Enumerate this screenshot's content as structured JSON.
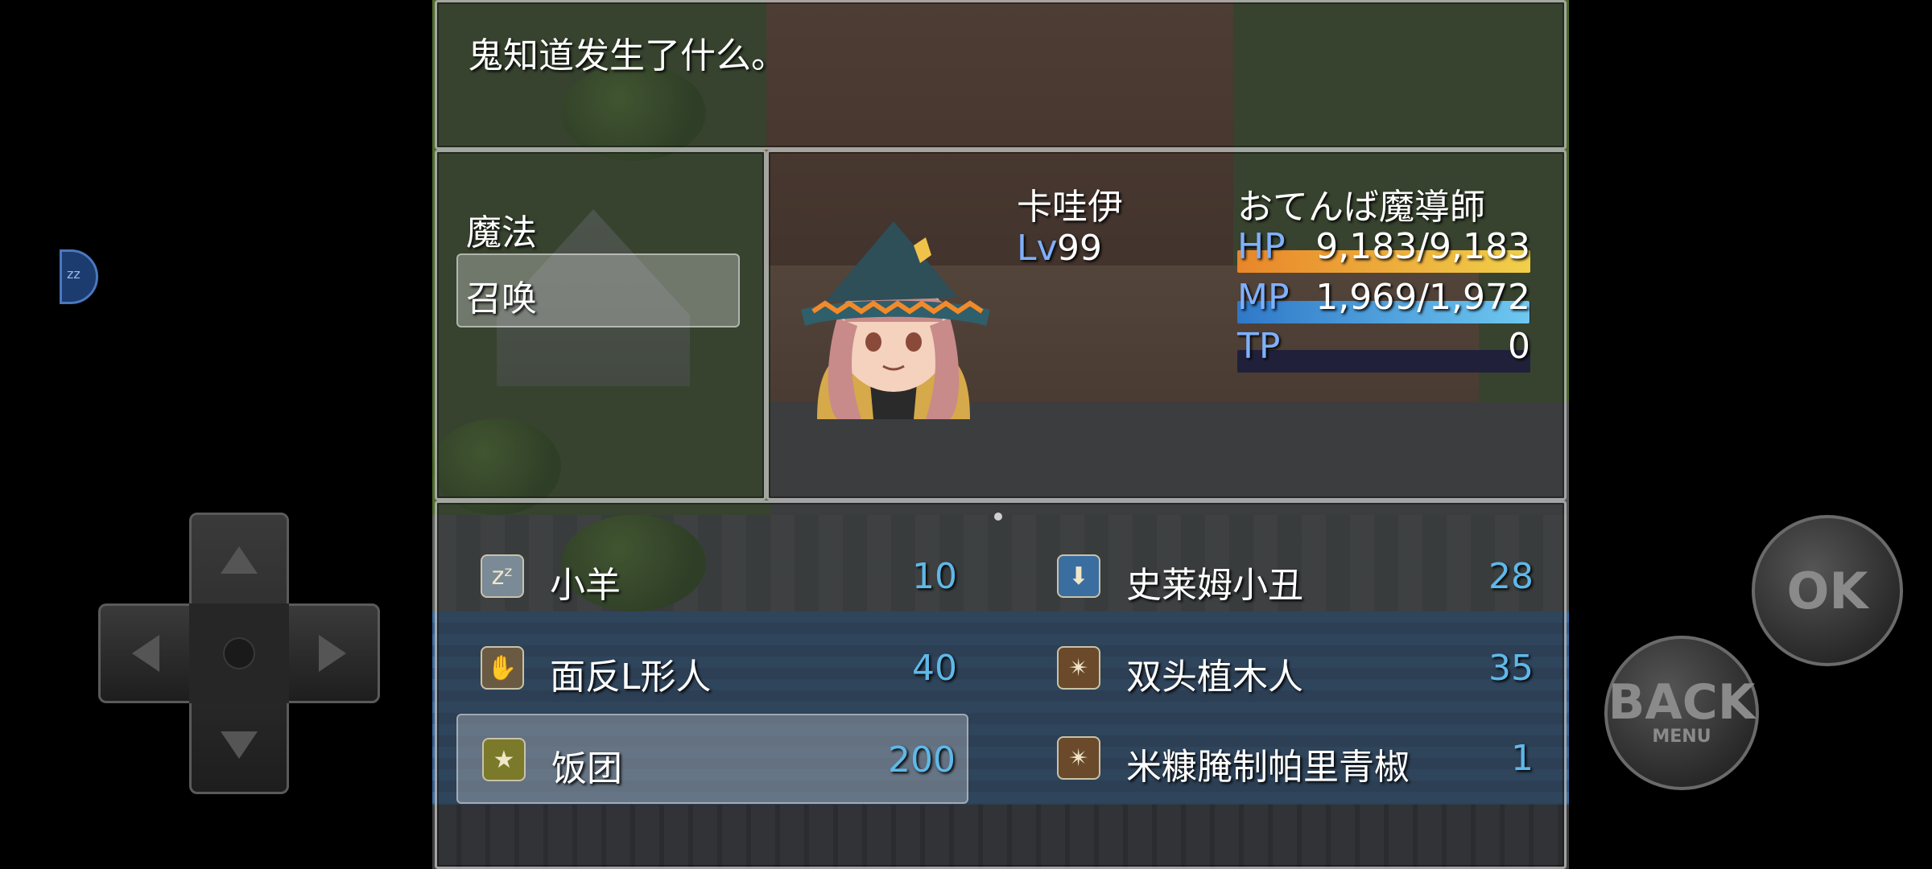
{
  "message": {
    "text": "鬼知道发生了什么。"
  },
  "command_menu": {
    "items": [
      "魔法",
      "召唤"
    ],
    "selected_index": 1
  },
  "actor": {
    "name": "卡哇伊",
    "class": "おてんば魔導師",
    "level_label": "Lv",
    "level": "99",
    "hp_label": "HP",
    "hp": "9,183/9,183",
    "hp_fraction": 1.0,
    "mp_label": "MP",
    "mp": "1,969/1,972",
    "mp_fraction": 0.998,
    "tp_label": "TP",
    "tp": "0",
    "tp_fraction": 0.0
  },
  "skills": [
    {
      "name": "小羊",
      "cost": "10",
      "icon": "sleep-zzz-icon"
    },
    {
      "name": "史莱姆小丑",
      "cost": "28",
      "icon": "water-drop-icon"
    },
    {
      "name": "面反L形人",
      "cost": "40",
      "icon": "claw-icon"
    },
    {
      "name": "双头植木人",
      "cost": "35",
      "icon": "slash-icon"
    },
    {
      "name": "饭团",
      "cost": "200",
      "icon": "star-icon"
    },
    {
      "name": "米糠腌制帕里青椒",
      "cost": "1",
      "icon": "slash-icon"
    }
  ],
  "skills_selected_index": 4,
  "controls": {
    "ok_label": "OK",
    "back_label": "BACK",
    "menu_label": "MENU",
    "float_button_label": "zz"
  },
  "colors": {
    "hp_gradient": [
      "#e8862a",
      "#f1d04a"
    ],
    "mp_gradient": [
      "#2f78c8",
      "#6ec8f0"
    ],
    "cost_text": "#5fb8e8",
    "level_label": "#7fb0ff"
  }
}
